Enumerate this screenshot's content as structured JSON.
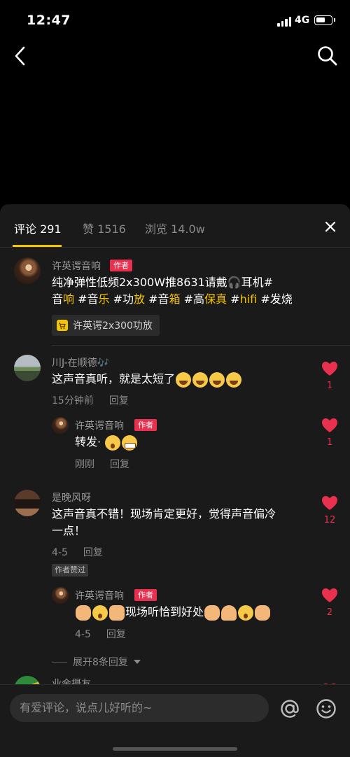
{
  "status_bar": {
    "time": "12:47",
    "network": "4G",
    "battery_level": 0.65
  },
  "tabs": {
    "comments_label": "评论 291",
    "likes_label": "赞 1516",
    "views_label": "浏览 14.0w"
  },
  "comments": [
    {
      "name": "许英谔音响",
      "author_tag": "作者",
      "text_line1": "纯净弹性低频2x300W推8631请戴🎧耳机#",
      "tags_line2": [
        {
          "plain": "音",
          "hl": "响"
        },
        {
          "plain": " #音",
          "hl": "乐"
        },
        {
          "plain": " #功",
          "hl": "放"
        },
        {
          "plain": " #音",
          "hl": "箱"
        },
        {
          "plain": " #高",
          "hl": "保真"
        },
        {
          "plain": " #",
          "hl": "hifi"
        },
        {
          "plain": " #发烧",
          "hl": ""
        }
      ],
      "product": "许英谔2x300功放"
    },
    {
      "name": "川J-在顺德🎶",
      "text": "这声音真听，就是太短了",
      "time": "15分钟前",
      "reply": "回复",
      "likes": "1"
    },
    {
      "name": "许英谔音响",
      "author_tag": "作者",
      "text": "转发·",
      "time": "刚刚",
      "reply": "回复",
      "likes": "1"
    },
    {
      "name": "是晚风呀",
      "text_line1": "这声音真不错！现场肯定更好，觉得声音偏冷",
      "text_line2": "一点！",
      "time": "4-5",
      "reply": "回复",
      "liked_tag": "作者赞过",
      "likes": "12"
    },
    {
      "name": "许英谔音响",
      "author_tag": "作者",
      "text": "现场听恰到好处",
      "time": "4-5",
      "reply": "回复",
      "likes": "2"
    },
    {
      "name": "业余摄友"
    }
  ],
  "expand_label": "展开8条回复",
  "input": {
    "placeholder": "有爱评论，说点儿好听的~"
  },
  "colors": {
    "accent": "#f5c400",
    "like_red": "#e9304f",
    "panel": "#1a1a1a"
  },
  "icons": [
    "back-icon",
    "search-icon",
    "close-icon",
    "heart-icon",
    "cart-icon",
    "at-icon",
    "emoji-icon",
    "chevron-down-icon"
  ]
}
